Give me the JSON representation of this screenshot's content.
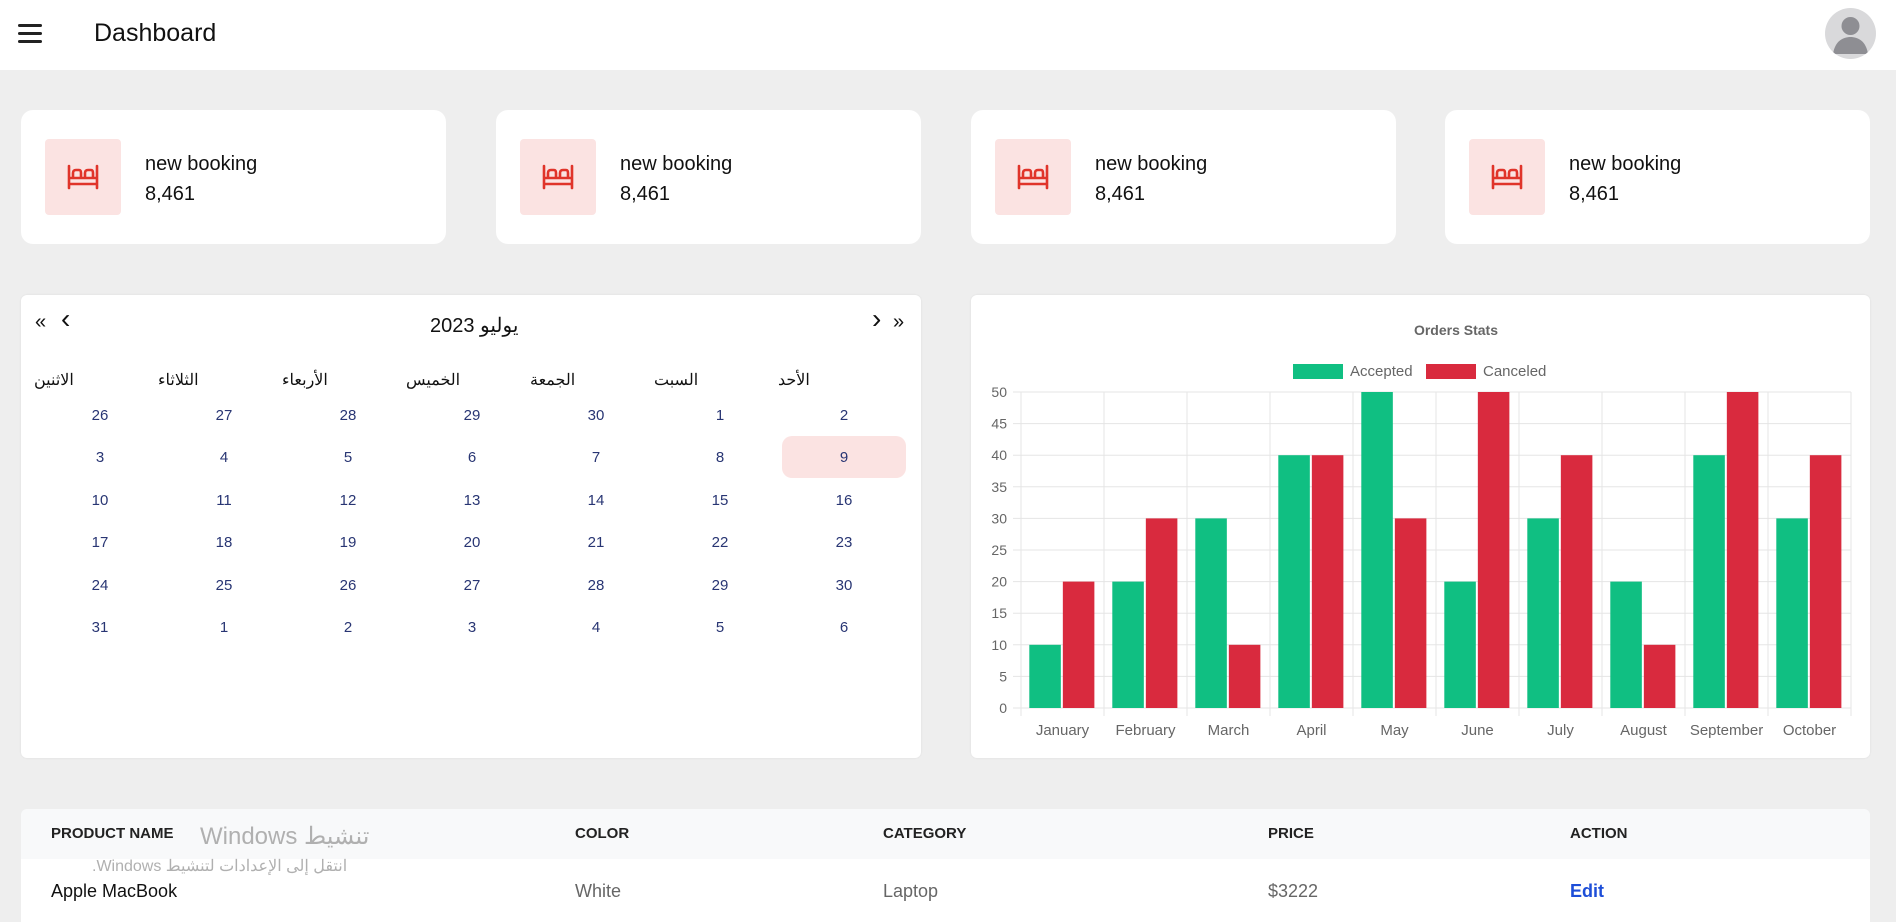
{
  "header": {
    "title": "Dashboard"
  },
  "stats": [
    {
      "label": "new booking",
      "value": "8,461"
    },
    {
      "label": "new booking",
      "value": "8,461"
    },
    {
      "label": "new booking",
      "value": "8,461"
    },
    {
      "label": "new booking",
      "value": "8,461"
    }
  ],
  "colors": {
    "accent": "#e0342a",
    "accent_soft": "#fbe3e2",
    "accepted": "#10bf82",
    "canceled": "#d92a3e",
    "link": "#1d4ed8"
  },
  "calendar": {
    "title": "يوليو 2023",
    "prev_year": "«",
    "prev_month": "‹",
    "next_month": "›",
    "next_year": "»",
    "weekdays": [
      "الأحد",
      "السبت",
      "الجمعة",
      "الخميس",
      "الأربعاء",
      "الثلاثاء",
      "الاثنين"
    ],
    "weeks": [
      [
        "2",
        "1",
        "30",
        "29",
        "28",
        "27",
        "26"
      ],
      [
        "9",
        "8",
        "7",
        "6",
        "5",
        "4",
        "3"
      ],
      [
        "16",
        "15",
        "14",
        "13",
        "12",
        "11",
        "10"
      ],
      [
        "23",
        "22",
        "21",
        "20",
        "19",
        "18",
        "17"
      ],
      [
        "30",
        "29",
        "28",
        "27",
        "26",
        "25",
        "24"
      ],
      [
        "6",
        "5",
        "4",
        "3",
        "2",
        "1",
        "31"
      ]
    ],
    "selected": "9"
  },
  "chart_data": {
    "type": "bar",
    "title": "Orders Stats",
    "categories": [
      "January",
      "February",
      "March",
      "April",
      "May",
      "June",
      "July",
      "August",
      "September",
      "October"
    ],
    "series": [
      {
        "name": "Accepted",
        "color": "#10bf82",
        "values": [
          10,
          20,
          30,
          40,
          50,
          20,
          30,
          20,
          40,
          30
        ]
      },
      {
        "name": "Canceled",
        "color": "#d92a3e",
        "values": [
          20,
          30,
          10,
          40,
          30,
          50,
          40,
          10,
          50,
          40
        ]
      }
    ],
    "ylim": [
      0,
      50
    ],
    "yticks": [
      "0",
      "5",
      "10",
      "15",
      "20",
      "25",
      "30",
      "35",
      "40",
      "45",
      "50"
    ],
    "grid": true,
    "legend": "top"
  },
  "table": {
    "headers": [
      "PRODUCT NAME",
      "COLOR",
      "CATEGORY",
      "PRICE",
      "ACTION"
    ],
    "rows": [
      {
        "name": "Apple MacBook",
        "color": "White",
        "category": "Laptop",
        "price": "$3222",
        "action": "Edit"
      }
    ]
  },
  "watermark": {
    "title": "تنشيط Windows",
    "subtitle": "انتقل إلى الإعدادات لتنشيط Windows."
  }
}
